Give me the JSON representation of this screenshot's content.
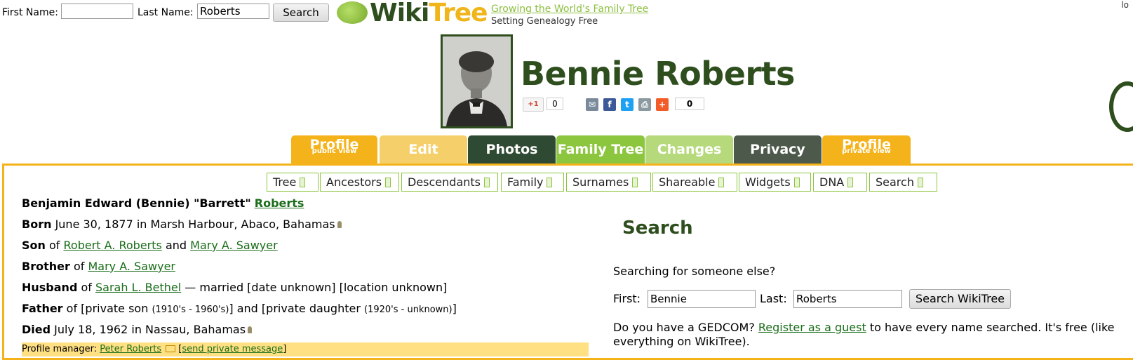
{
  "topbar": {
    "first_label": "First Name:",
    "first_value": "",
    "last_label": "Last Name:",
    "last_value": "Roberts",
    "search_label": "Search",
    "corner_text": "lo"
  },
  "logo": {
    "wiki": "Wiki",
    "tree": "Tree",
    "tagline": "Growing the World's Family Tree",
    "tagline2": "Setting Genealogy Free"
  },
  "profile": {
    "name": "Bennie Roberts",
    "gplus_label": "+1",
    "gplus_count": "0",
    "share_count": "0"
  },
  "tabs": [
    {
      "label": "Profile",
      "sub": "public view",
      "color": "#f4b31b"
    },
    {
      "label": "Edit",
      "sub": "",
      "color": "#f5d06a"
    },
    {
      "label": "Photos",
      "sub": "",
      "color": "#2f4a33"
    },
    {
      "label": "Family Tree",
      "sub": "",
      "color": "#8cc63f"
    },
    {
      "label": "Changes",
      "sub": "",
      "color": "#b6d97b"
    },
    {
      "label": "Privacy",
      "sub": "",
      "color": "#4d5a4b"
    },
    {
      "label": "Profile",
      "sub": "private view",
      "color": "#f4b31b"
    }
  ],
  "subnav": [
    "Tree",
    "Ancestors",
    "Descendants",
    "Family",
    "Surnames",
    "Shareable",
    "Widgets",
    "DNA",
    "Search"
  ],
  "bio": {
    "fullname_prefix": "Benjamin Edward (Bennie) \"Barrett\"",
    "fullname_surname": "Roberts",
    "born_label": "Born",
    "born_text": "June 30, 1877 in Marsh Harbour, Abaco, Bahamas",
    "son_label": "Son",
    "of": "of",
    "and": "and",
    "father_link": "Robert A. Roberts",
    "mother_link": "Mary A. Sawyer",
    "brother_label": "Brother",
    "brother_of": "of",
    "sibling_link": "Mary A. Sawyer",
    "husband_label": "Husband",
    "husband_of": "of",
    "spouse_link": "Sarah L. Bethel",
    "married_text": "— married [date unknown] [location unknown]",
    "father_label": "Father",
    "father_of": "of [private son",
    "child1_years": "(1910's - 1960's)",
    "father_mid": "] and [private daughter",
    "child2_years": "(1920's - unknown)",
    "father_end": "]",
    "died_label": "Died",
    "died_text": "July 18, 1962 in Nassau, Bahamas"
  },
  "manager": {
    "label": "Profile manager:",
    "name": "Peter Roberts",
    "message_link": "send private message",
    "bracket_open": "[",
    "bracket_close": "]"
  },
  "search_panel": {
    "heading": "Search",
    "question": "Searching for someone else?",
    "first_label": "First:",
    "first_value": "Bennie",
    "last_label": "Last:",
    "last_value": "Roberts",
    "button_label": "Search WikiTree",
    "gedcom_before": "Do you have a GEDCOM?",
    "gedcom_link": "Register as a guest",
    "gedcom_after": "to have every name searched. It's free (like everything on WikiTree)."
  }
}
